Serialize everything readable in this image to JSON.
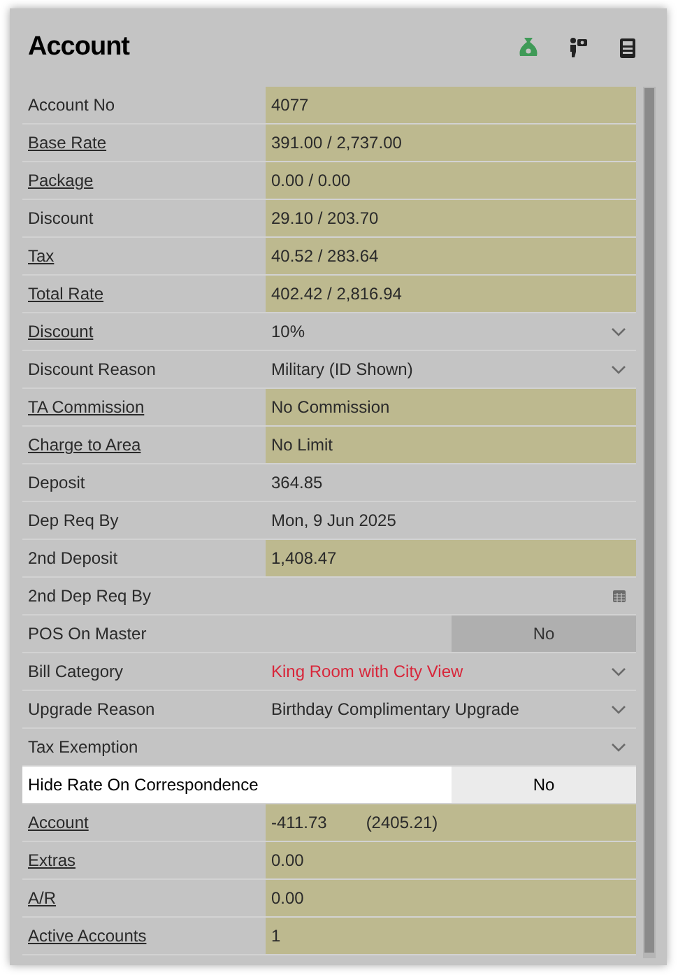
{
  "title": "Account",
  "rows": [
    {
      "label": "Account No",
      "link": false,
      "kind": "text",
      "value": "4077",
      "filled": true,
      "selected": false
    },
    {
      "label": "Base Rate",
      "link": true,
      "kind": "text",
      "value": "391.00 / 2,737.00",
      "filled": true,
      "selected": false
    },
    {
      "label": "Package",
      "link": true,
      "kind": "text",
      "value": "0.00 / 0.00",
      "filled": true,
      "selected": false
    },
    {
      "label": "Discount",
      "link": false,
      "kind": "text",
      "value": "29.10 / 203.70",
      "filled": true,
      "selected": false
    },
    {
      "label": "Tax",
      "link": true,
      "kind": "text",
      "value": "40.52 / 283.64",
      "filled": true,
      "selected": false
    },
    {
      "label": "Total Rate",
      "link": true,
      "kind": "text",
      "value": "402.42 / 2,816.94",
      "filled": true,
      "selected": false
    },
    {
      "label": "Discount",
      "link": true,
      "kind": "dropdown",
      "value": "10%",
      "filled": false,
      "selected": false
    },
    {
      "label": "Discount Reason",
      "link": false,
      "kind": "dropdown",
      "value": "Military (ID Shown)",
      "filled": false,
      "selected": false
    },
    {
      "label": "TA Commission",
      "link": true,
      "kind": "text",
      "value": "No Commission",
      "filled": true,
      "selected": false
    },
    {
      "label": "Charge to Area",
      "link": true,
      "kind": "text",
      "value": "No Limit",
      "filled": true,
      "selected": false
    },
    {
      "label": "Deposit",
      "link": false,
      "kind": "text",
      "value": "364.85",
      "filled": false,
      "selected": false
    },
    {
      "label": "Dep Req By",
      "link": false,
      "kind": "text",
      "value": "Mon, 9 Jun 2025",
      "filled": false,
      "selected": false
    },
    {
      "label": "2nd Deposit",
      "link": false,
      "kind": "text",
      "value": "1,408.47",
      "filled": true,
      "selected": false
    },
    {
      "label": "2nd Dep Req By",
      "link": false,
      "kind": "date",
      "filled": false,
      "selected": false
    },
    {
      "label": "POS On Master",
      "link": false,
      "kind": "toggle",
      "value": "No",
      "filled": false,
      "selected": false
    },
    {
      "label": "Bill Category",
      "link": false,
      "kind": "dropdown",
      "value": "King Room with City View",
      "filled": false,
      "alert": true,
      "selected": false
    },
    {
      "label": "Upgrade Reason",
      "link": false,
      "kind": "dropdown",
      "value": "Birthday Complimentary Upgrade",
      "filled": false,
      "selected": false
    },
    {
      "label": "Tax Exemption",
      "link": false,
      "kind": "dropdown",
      "filled": false,
      "selected": false
    },
    {
      "label": "Hide Rate On Correspondence",
      "link": false,
      "kind": "toggle",
      "value": "No",
      "filled": false,
      "selected": true
    },
    {
      "label": "Account",
      "link": true,
      "kind": "text",
      "value": "-411.73",
      "value2": "(2405.21)",
      "filled": true,
      "selected": false
    },
    {
      "label": "Extras",
      "link": true,
      "kind": "text",
      "value": "0.00",
      "filled": true,
      "selected": false
    },
    {
      "label": "A/R",
      "link": true,
      "kind": "text",
      "value": "0.00",
      "filled": true,
      "selected": false
    },
    {
      "label": "Active Accounts",
      "link": true,
      "kind": "text",
      "value": "1",
      "filled": true,
      "selected": false
    }
  ]
}
